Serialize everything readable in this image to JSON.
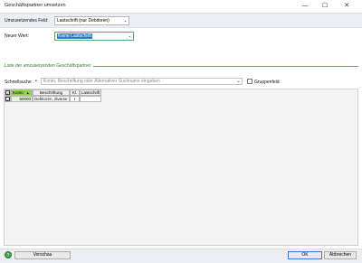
{
  "window": {
    "title": "Geschäftspartner umsetzen",
    "minimize_glyph": "—",
    "maximize_glyph": "☐",
    "close_glyph": "✕"
  },
  "field_row": {
    "label": "Umzusetzendes Feld:",
    "selected_value": "Lastschrift (nur Debitoren)",
    "caret_glyph": "⌄"
  },
  "new_value": {
    "label": "Neuer Wert:",
    "selected_value": "Keine Lastschrift",
    "caret_glyph": "⌄"
  },
  "partner_list": {
    "section_title": "Liste der umzusetzenden Geschäftspartner",
    "quick_search_label": "Schnellsuche",
    "quick_search_placeholder": "Konto, Beschriftung oder Alternativer Suchname eingeben",
    "group_field_label": "Gruppenfeld",
    "columns": [
      "Konto",
      "Beschriftung",
      "Kl.",
      "Lastschrift"
    ],
    "sort_glyph": "▲",
    "rows": [
      {
        "checked": true,
        "konto": "50000",
        "beschriftung": "Debitoren, diverse",
        "kl": "I",
        "lastschrift": ""
      }
    ]
  },
  "footer": {
    "help_glyph": "?",
    "preview_label": "Vorschau",
    "ok_label": "OK",
    "cancel_label": "Abbrechen"
  },
  "colors": {
    "accent_green": "#8fd14f",
    "selection_blue": "#2a7ad4",
    "section_green": "#66b06b"
  }
}
